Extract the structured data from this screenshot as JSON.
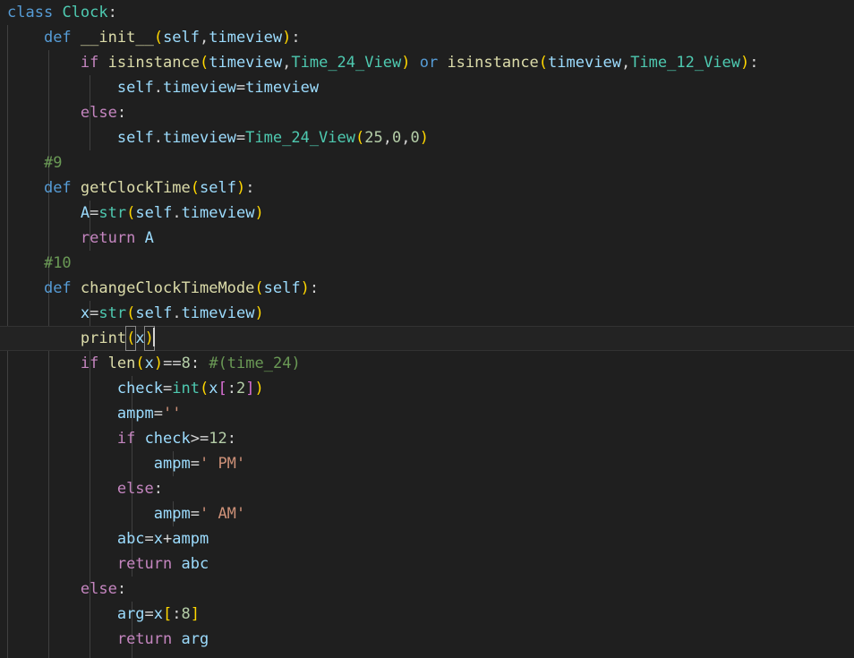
{
  "editor": {
    "language": "python",
    "theme": "dark-plus",
    "background_color": "#1f1f1f",
    "active_line_background": "#232323",
    "indent_guide_color": "#404040",
    "font_size_px": 17,
    "line_height_px": 28,
    "active_line_number": 14,
    "cursor_after_text": "print(x)",
    "bracket_match_tokens": [
      "(",
      ")"
    ],
    "colors": {
      "keyword": "#569cd6",
      "control": "#c586c0",
      "type": "#4ec9b0",
      "function": "#dcdcaa",
      "variable": "#9cdcfe",
      "number": "#b5cea8",
      "string": "#ce9178",
      "comment": "#6a9955",
      "plain": "#d4d4d4",
      "bracket_1": "#ffd700",
      "bracket_2": "#da70d6",
      "bracket_3": "#179fff",
      "caret": "#d4d4d4"
    },
    "indent_guide_x": [
      8,
      54,
      100,
      147,
      193,
      239
    ]
  },
  "code": {
    "lines": [
      "class Clock:",
      "    def __init__(self,timeview):",
      "        if isinstance(timeview,Time_24_View) or isinstance(timeview,Time_12_View):",
      "            self.timeview=timeview",
      "        else:",
      "            self.timeview=Time_24_View(25,0,0)",
      "    #9",
      "    def getClockTime(self):",
      "        A=str(self.timeview)",
      "        return A",
      "    #10",
      "    def changeClockTimeMode(self):",
      "        x=str(self.timeview)",
      "        print(x)",
      "        if len(x)==8: #(time_24)",
      "            check=int(x[:2])",
      "            ampm=''",
      "            if check>=12:",
      "                ampm=' PM'",
      "            else:",
      "                ampm=' AM'",
      "            abc=x+ampm",
      "            return abc",
      "        else:",
      "            arg=x[:8]",
      "            return arg"
    ],
    "tokens": {
      "l1": {
        "kw": "class",
        "type": "Clock",
        "colon": ":"
      },
      "l2": {
        "kw": "def",
        "fn": "__init__",
        "p1": "(",
        "v1": "self",
        "c1": ",",
        "v2": "timeview",
        "p2": ")",
        "colon": ":"
      },
      "l3": {
        "ctl": "if",
        "fn": "isinstance",
        "p1": "(",
        "v1": "timeview",
        "c1": ",",
        "t1": "Time_24_View",
        "p2": ")",
        "kw": "or",
        "fn2": "isinstance",
        "p3": "(",
        "v2": "timeview",
        "c2": ",",
        "t2": "Time_12_View",
        "p4": ")",
        "colon": ":"
      },
      "l4": {
        "v1": "self",
        "dot": ".",
        "v2": "timeview",
        "eq": "=",
        "v3": "timeview"
      },
      "l5": {
        "ctl": "else",
        "colon": ":"
      },
      "l6": {
        "v1": "self",
        "dot": ".",
        "v2": "timeview",
        "eq": "=",
        "t1": "Time_24_View",
        "p1": "(",
        "n1": "25",
        "c1": ",",
        "n2": "0",
        "c2": ",",
        "n3": "0",
        "p2": ")"
      },
      "l7": {
        "com": "#9"
      },
      "l8": {
        "kw": "def",
        "fn": "getClockTime",
        "p1": "(",
        "v1": "self",
        "p2": ")",
        "colon": ":"
      },
      "l9": {
        "v1": "A",
        "eq": "=",
        "t1": "str",
        "p1": "(",
        "v2": "self",
        "dot": ".",
        "v3": "timeview",
        "p2": ")"
      },
      "l10": {
        "ctl": "return",
        "v1": "A"
      },
      "l11": {
        "com": "#10"
      },
      "l12": {
        "kw": "def",
        "fn": "changeClockTimeMode",
        "p1": "(",
        "v1": "self",
        "p2": ")",
        "colon": ":"
      },
      "l13": {
        "v1": "x",
        "eq": "=",
        "t1": "str",
        "p1": "(",
        "v2": "self",
        "dot": ".",
        "v3": "timeview",
        "p2": ")"
      },
      "l14": {
        "fn": "print",
        "p1": "(",
        "v1": "x",
        "p2": ")"
      },
      "l15": {
        "ctl": "if",
        "fn": "len",
        "p1": "(",
        "v1": "x",
        "p2": ")",
        "op": "==",
        "n1": "8",
        "colon": ":",
        "com": "#(time_24)"
      },
      "l16": {
        "v1": "check",
        "eq": "=",
        "t1": "int",
        "p1": "(",
        "v2": "x",
        "b1": "[",
        "colon": ":",
        "n1": "2",
        "b2": "]",
        "p2": ")"
      },
      "l17": {
        "v1": "ampm",
        "eq": "=",
        "str": "''"
      },
      "l18": {
        "ctl": "if",
        "v1": "check",
        "op": ">=",
        "n1": "12",
        "colon": ":"
      },
      "l19": {
        "v1": "ampm",
        "eq": "=",
        "str": "' PM'"
      },
      "l20": {
        "ctl": "else",
        "colon": ":"
      },
      "l21": {
        "v1": "ampm",
        "eq": "=",
        "str": "' AM'"
      },
      "l22": {
        "v1": "abc",
        "eq": "=",
        "v2": "x",
        "op": "+",
        "v3": "ampm"
      },
      "l23": {
        "ctl": "return",
        "v1": "abc"
      },
      "l24": {
        "ctl": "else",
        "colon": ":"
      },
      "l25": {
        "v1": "arg",
        "eq": "=",
        "v2": "x",
        "b1": "[",
        "colon": ":",
        "n1": "8",
        "b2": "]"
      },
      "l26": {
        "ctl": "return",
        "v1": "arg"
      }
    }
  }
}
